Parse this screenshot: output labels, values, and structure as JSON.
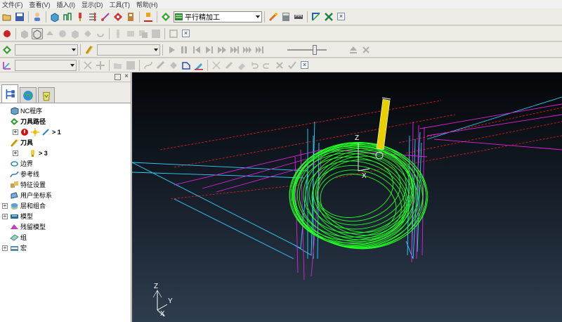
{
  "menu": [
    "文件(F)",
    "查看(V)",
    "插入(I)",
    "显示(D)",
    "工具(T)",
    "帮助(H)"
  ],
  "toolbar": {
    "strategy_value": "平行精加工"
  },
  "panel": {
    "tree": [
      {
        "label": "NC程序",
        "bold": false,
        "icon": "nc-program-icon"
      },
      {
        "label": "刀具路径",
        "bold": true,
        "icon": "toolpath-icon"
      },
      {
        "label": "> 1",
        "bold": true,
        "icon": "toolpath-item-icon"
      },
      {
        "label": "刀具",
        "bold": true,
        "icon": "tool-icon"
      },
      {
        "label": "> 3",
        "bold": true,
        "icon": "tool-item-icon"
      },
      {
        "label": "边界",
        "bold": false,
        "icon": "boundary-icon"
      },
      {
        "label": "参考线",
        "bold": false,
        "icon": "pattern-icon"
      },
      {
        "label": "特征设置",
        "bold": false,
        "icon": "feature-set-icon"
      },
      {
        "label": "用户坐标系",
        "bold": false,
        "icon": "workplane-icon"
      },
      {
        "label": "层和组合",
        "bold": false,
        "icon": "level-icon"
      },
      {
        "label": "模型",
        "bold": false,
        "icon": "model-icon"
      },
      {
        "label": "残留模型",
        "bold": false,
        "icon": "stock-model-icon"
      },
      {
        "label": "组",
        "bold": false,
        "icon": "group-icon"
      },
      {
        "label": "宏",
        "bold": false,
        "icon": "macro-icon"
      }
    ]
  },
  "axes": {
    "z": "Z",
    "x": "X",
    "y": "Y"
  },
  "colors": {
    "viewport_top": "#040608",
    "viewport_bottom": "#2e3d4e",
    "toolpath_green": "#22ff22",
    "link_magenta": "#e020e0",
    "cyan": "#30d0ff",
    "tool_yellow": "#e8d000"
  }
}
